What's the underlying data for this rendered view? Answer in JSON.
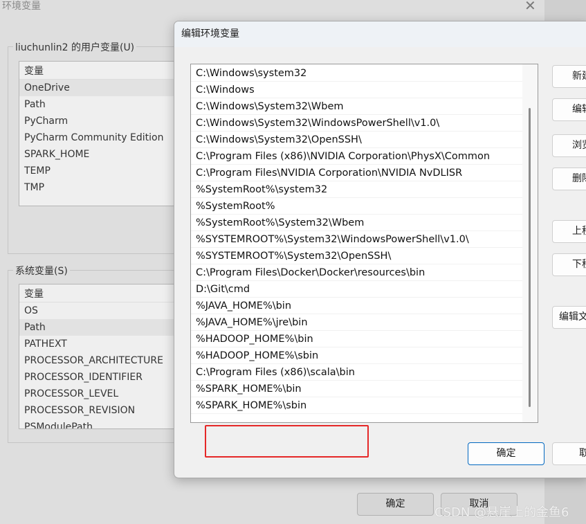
{
  "background_window": {
    "title": "环境变量",
    "close": "✕",
    "user_group": {
      "label": "liuchunlin2 的用户变量(U)",
      "header": "变量",
      "items": [
        "OneDrive",
        "Path",
        "PyCharm",
        "PyCharm Community Edition",
        "SPARK_HOME",
        "TEMP",
        "TMP"
      ]
    },
    "system_group": {
      "label": "系统变量(S)",
      "header": "变量",
      "items": [
        "OS",
        "Path",
        "PATHEXT",
        "PROCESSOR_ARCHITECTURE",
        "PROCESSOR_IDENTIFIER",
        "PROCESSOR_LEVEL",
        "PROCESSOR_REVISION",
        "PSModulePath"
      ]
    },
    "ok": "确定",
    "cancel": "取消"
  },
  "dialog": {
    "title": "编辑环境变量",
    "paths": [
      "C:\\Windows\\system32",
      "C:\\Windows",
      "C:\\Windows\\System32\\Wbem",
      "C:\\Windows\\System32\\WindowsPowerShell\\v1.0\\",
      "C:\\Windows\\System32\\OpenSSH\\",
      "C:\\Program Files (x86)\\NVIDIA Corporation\\PhysX\\Common",
      "C:\\Program Files\\NVIDIA Corporation\\NVIDIA NvDLISR",
      "%SystemRoot%\\system32",
      "%SystemRoot%",
      "%SystemRoot%\\System32\\Wbem",
      "%SYSTEMROOT%\\System32\\WindowsPowerShell\\v1.0\\",
      "%SYSTEMROOT%\\System32\\OpenSSH\\",
      "C:\\Program Files\\Docker\\Docker\\resources\\bin",
      "D:\\Git\\cmd",
      "%JAVA_HOME%\\bin",
      "%JAVA_HOME%\\jre\\bin",
      "%HADOOP_HOME%\\bin",
      "%HADOOP_HOME%\\sbin",
      "C:\\Program Files (x86)\\scala\\bin",
      "%SPARK_HOME%\\bin",
      "%SPARK_HOME%\\sbin"
    ],
    "buttons": {
      "new": "新建",
      "edit": "编辑",
      "browse": "浏览",
      "delete": "删除",
      "up": "上移",
      "down": "下移",
      "edit_text": "编辑文本"
    },
    "ok": "确定",
    "cancel": "取消",
    "highlight_color": "#e52727"
  },
  "watermark": "CSDN @悬崖上的金鱼6"
}
